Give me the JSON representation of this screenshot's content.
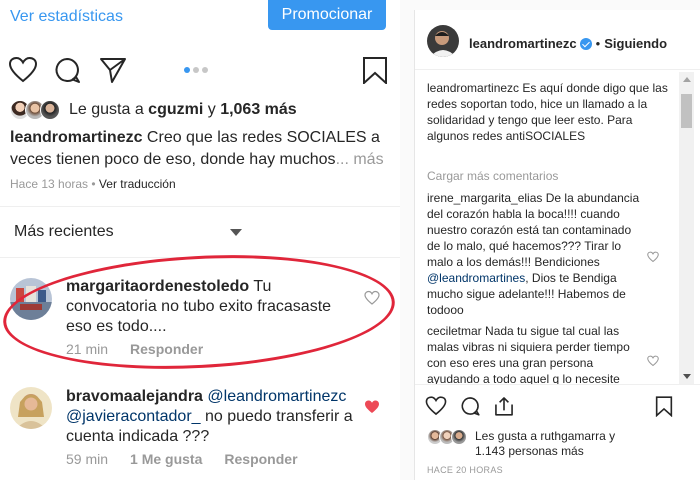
{
  "left": {
    "stats_link": "Ver estadísticas",
    "promote_button": "Promocionar",
    "carousel": {
      "count": 3,
      "active": 0
    },
    "likes": {
      "prefix": "Le gusta a ",
      "user": "cguzmi",
      "conj": " y ",
      "count": "1,063 más"
    },
    "caption": {
      "user": "leandromartinezc",
      "text": " Creo que las redes SOCIALES a veces tienen poco de eso, donde hay muchos",
      "ellipsis": "...",
      "more": " más"
    },
    "time": {
      "ago": "Hace 13 horas",
      "sep": " • ",
      "translate": "Ver traducción"
    },
    "sort": {
      "label": "Más recientes"
    },
    "comments": [
      {
        "user": "margaritaordenestoledo",
        "text": " Tu convocatoria no tubo exito fracasaste eso es todo....",
        "time": "21 min",
        "reply": "Responder",
        "liked": false
      },
      {
        "user": "bravomaalejandra",
        "mention1": " @leandromartinezc",
        "mention2": "@javieracontador_",
        "text": " no puedo transferir a cuenta indicada ???",
        "time": "59 min",
        "likes": "1 Me gusta",
        "reply": "Responder",
        "liked": true
      }
    ],
    "accent_color": "#3897f0",
    "highlight_color": "#e0263a",
    "liked_color": "#ed4956"
  },
  "right": {
    "header": {
      "user": "leandromartinezc",
      "sep": "•",
      "follow": "Siguiendo"
    },
    "caption": {
      "user": "leandromartinezc",
      "text": " Es aquí donde digo que las redes soportan todo, hice un llamado a la solidaridad y tengo que leer esto. Para algunos redes antiSOCIALES"
    },
    "load_more": "Cargar más comentarios",
    "comments": [
      {
        "user": "irene_margarita_elias",
        "text": " De la abundancia del corazón habla la boca!!!! cuando nuestro corazón está tan contaminado de lo malo, qué hacemos??? Tirar lo malo a los demás!!! Bendiciones ",
        "mention": "@leandromartines",
        "text2": ", Dios te Bendiga mucho sigue adelante!!! Habemos de todooo"
      },
      {
        "user": "ceciletmar",
        "text": " Nada tu sigue tal cual las malas vibras ni siquiera perder tiempo con eso eres una gran persona ayudando a todo aquel q lo necesite"
      }
    ],
    "likes": {
      "prefix": "Les gusta a ",
      "user": "ruthgamarra",
      "conj": " y ",
      "count": "1.143 personas más"
    },
    "time": "HACE 20 HORAS"
  }
}
